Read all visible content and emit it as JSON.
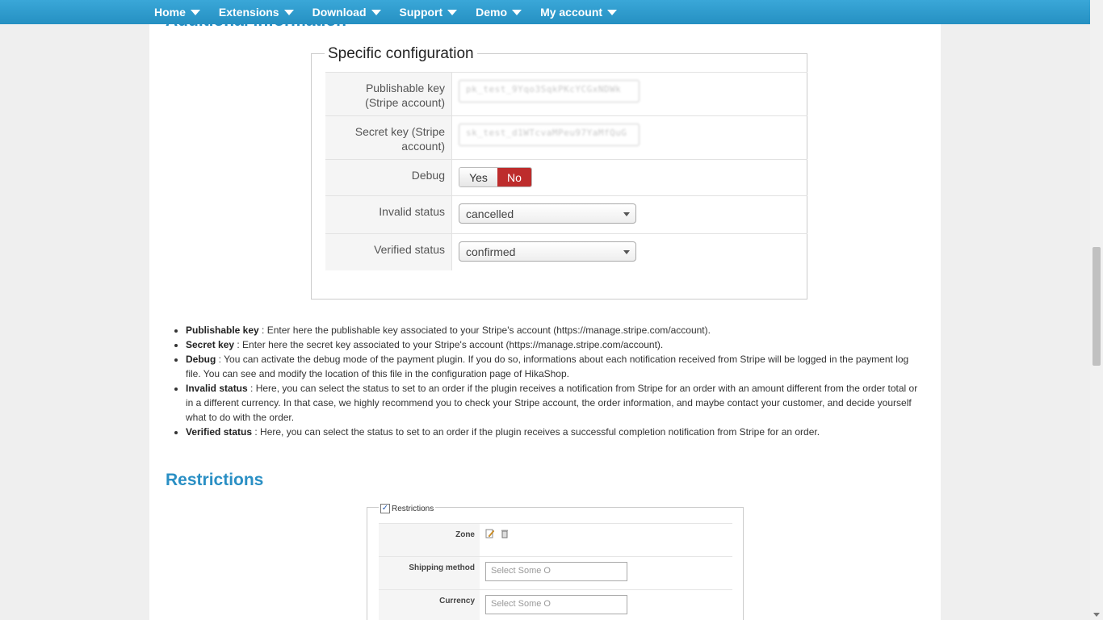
{
  "nav": {
    "items": [
      {
        "label": "Home"
      },
      {
        "label": "Extensions"
      },
      {
        "label": "Download"
      },
      {
        "label": "Support"
      },
      {
        "label": "Demo"
      },
      {
        "label": "My account"
      }
    ]
  },
  "partial_heading": "Additional information",
  "config": {
    "legend": "Specific configuration",
    "publishable_key": {
      "label": "Publishable key (Stripe account)",
      "value": "pk_test_9Yqo3SqkPKcYCGxNDWk"
    },
    "secret_key": {
      "label": "Secret key (Stripe account)",
      "value": "sk_test_d1WTcvaMPeu97YaMfQuG"
    },
    "debug": {
      "label": "Debug",
      "yes": "Yes",
      "no": "No",
      "selected": "No"
    },
    "invalid_status": {
      "label": "Invalid status",
      "value": "cancelled"
    },
    "verified_status": {
      "label": "Verified status",
      "value": "confirmed"
    }
  },
  "descriptions": [
    {
      "term": "Publishable key",
      "text": " : Enter here the publishable key associated to your Stripe's account (https://manage.stripe.com/account)."
    },
    {
      "term": "Secret key",
      "text": " : Enter here the secret key associated to your Stripe's account (https://manage.stripe.com/account)."
    },
    {
      "term": "Debug",
      "text": " : You can activate the debug mode of the payment plugin. If you do so, informations about each notification received from Stripe will be logged in the payment log file. You can see and modify the location of this file in the configuration page of HikaShop."
    },
    {
      "term": "Invalid status",
      "text": " : Here, you can select the status to set to an order if the plugin receives a notification from Stripe for an order with an amount different from the order total or in a different currency. In that case, we highly recommend you to check your Stripe account, the order information, and maybe contact your customer, and decide yourself what to do with the order."
    },
    {
      "term": "Verified status",
      "text": " : Here, you can select the status to set to an order if the plugin receives a successful completion notification from Stripe for an order."
    }
  ],
  "restrictions": {
    "heading": "Restrictions",
    "legend": "Restrictions",
    "zone": {
      "label": "Zone"
    },
    "shipping": {
      "label": "Shipping method",
      "placeholder": "Select Some O"
    },
    "currency": {
      "label": "Currency",
      "placeholder": "Select Some O"
    }
  }
}
